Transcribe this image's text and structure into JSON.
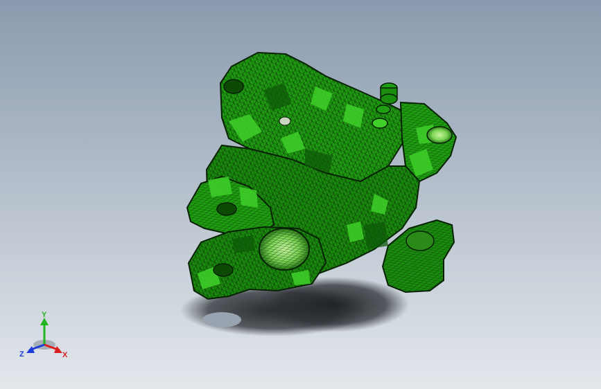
{
  "viewport": {
    "background_top": "#8a9aae",
    "background_bottom": "#e3e7ec"
  },
  "part": {
    "fill_color": "#1f9e12",
    "highlight_color": "#3fd02a",
    "mesh_color": "#0a2a06",
    "shadow_color": "#2c2f34"
  },
  "triad": {
    "x_label": "X",
    "y_label": "Y",
    "z_label": "Z",
    "x_color": "#d81e1e",
    "y_color": "#22b422",
    "z_color": "#1e3cd8"
  }
}
